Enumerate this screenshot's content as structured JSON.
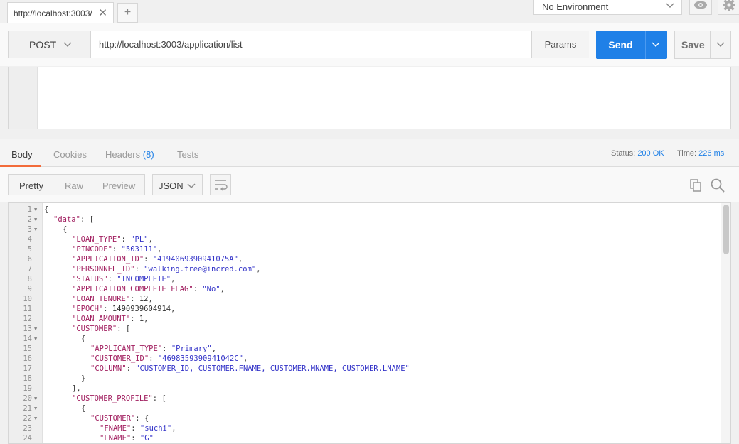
{
  "tab": {
    "title": "http://localhost:3003/",
    "close": "✕",
    "new": "+"
  },
  "environment": {
    "selected": "No Environment"
  },
  "request": {
    "method": "POST",
    "url": "http://localhost:3003/application/list",
    "params_label": "Params",
    "send_label": "Send",
    "save_label": "Save"
  },
  "response_tabs": {
    "body": "Body",
    "cookies": "Cookies",
    "headers": "Headers",
    "headers_count": "(8)",
    "tests": "Tests"
  },
  "status": {
    "label": "Status:",
    "value": "200 OK"
  },
  "time": {
    "label": "Time:",
    "value": "226 ms"
  },
  "view": {
    "pretty": "Pretty",
    "raw": "Raw",
    "preview": "Preview",
    "format": "JSON"
  },
  "code_lines": [
    {
      "n": "1",
      "fold": true,
      "indent": 0,
      "parts": [
        [
          "p",
          "{"
        ]
      ]
    },
    {
      "n": "2",
      "fold": true,
      "indent": 1,
      "parts": [
        [
          "k",
          "\"data\""
        ],
        [
          "p",
          ": ["
        ]
      ]
    },
    {
      "n": "3",
      "fold": true,
      "indent": 2,
      "parts": [
        [
          "p",
          "{"
        ]
      ]
    },
    {
      "n": "4",
      "fold": false,
      "indent": 3,
      "parts": [
        [
          "k",
          "\"LOAN_TYPE\""
        ],
        [
          "p",
          ": "
        ],
        [
          "s",
          "\"PL\""
        ],
        [
          "p",
          ","
        ]
      ]
    },
    {
      "n": "5",
      "fold": false,
      "indent": 3,
      "parts": [
        [
          "k",
          "\"PINCODE\""
        ],
        [
          "p",
          ": "
        ],
        [
          "s",
          "\"503111\""
        ],
        [
          "p",
          ","
        ]
      ]
    },
    {
      "n": "6",
      "fold": false,
      "indent": 3,
      "parts": [
        [
          "k",
          "\"APPLICATION_ID\""
        ],
        [
          "p",
          ": "
        ],
        [
          "s",
          "\"4194069390941075A\""
        ],
        [
          "p",
          ","
        ]
      ]
    },
    {
      "n": "7",
      "fold": false,
      "indent": 3,
      "parts": [
        [
          "k",
          "\"PERSONNEL_ID\""
        ],
        [
          "p",
          ": "
        ],
        [
          "s",
          "\"walking.tree@incred.com\""
        ],
        [
          "p",
          ","
        ]
      ]
    },
    {
      "n": "8",
      "fold": false,
      "indent": 3,
      "parts": [
        [
          "k",
          "\"STATUS\""
        ],
        [
          "p",
          ": "
        ],
        [
          "s",
          "\"INCOMPLETE\""
        ],
        [
          "p",
          ","
        ]
      ]
    },
    {
      "n": "9",
      "fold": false,
      "indent": 3,
      "parts": [
        [
          "k",
          "\"APPLICATION_COMPLETE_FLAG\""
        ],
        [
          "p",
          ": "
        ],
        [
          "s",
          "\"No\""
        ],
        [
          "p",
          ","
        ]
      ]
    },
    {
      "n": "10",
      "fold": false,
      "indent": 3,
      "parts": [
        [
          "k",
          "\"LOAN_TENURE\""
        ],
        [
          "p",
          ": "
        ],
        [
          "n",
          "12"
        ],
        [
          "p",
          ","
        ]
      ]
    },
    {
      "n": "11",
      "fold": false,
      "indent": 3,
      "parts": [
        [
          "k",
          "\"EPOCH\""
        ],
        [
          "p",
          ": "
        ],
        [
          "n",
          "1490939604914"
        ],
        [
          "p",
          ","
        ]
      ]
    },
    {
      "n": "12",
      "fold": false,
      "indent": 3,
      "parts": [
        [
          "k",
          "\"LOAN_AMOUNT\""
        ],
        [
          "p",
          ": "
        ],
        [
          "n",
          "1"
        ],
        [
          "p",
          ","
        ]
      ]
    },
    {
      "n": "13",
      "fold": true,
      "indent": 3,
      "parts": [
        [
          "k",
          "\"CUSTOMER\""
        ],
        [
          "p",
          ": ["
        ]
      ]
    },
    {
      "n": "14",
      "fold": true,
      "indent": 4,
      "parts": [
        [
          "p",
          "{"
        ]
      ]
    },
    {
      "n": "15",
      "fold": false,
      "indent": 5,
      "parts": [
        [
          "k",
          "\"APPLICANT_TYPE\""
        ],
        [
          "p",
          ": "
        ],
        [
          "s",
          "\"Primary\""
        ],
        [
          "p",
          ","
        ]
      ]
    },
    {
      "n": "16",
      "fold": false,
      "indent": 5,
      "parts": [
        [
          "k",
          "\"CUSTOMER_ID\""
        ],
        [
          "p",
          ": "
        ],
        [
          "s",
          "\"4698359390941042C\""
        ],
        [
          "p",
          ","
        ]
      ]
    },
    {
      "n": "17",
      "fold": false,
      "indent": 5,
      "parts": [
        [
          "k",
          "\"COLUMN\""
        ],
        [
          "p",
          ": "
        ],
        [
          "s",
          "\"CUSTOMER_ID, CUSTOMER.FNAME, CUSTOMER.MNAME, CUSTOMER.LNAME\""
        ]
      ]
    },
    {
      "n": "18",
      "fold": false,
      "indent": 4,
      "parts": [
        [
          "p",
          "}"
        ]
      ]
    },
    {
      "n": "19",
      "fold": false,
      "indent": 3,
      "parts": [
        [
          "p",
          "],"
        ]
      ]
    },
    {
      "n": "20",
      "fold": true,
      "indent": 3,
      "parts": [
        [
          "k",
          "\"CUSTOMER_PROFILE\""
        ],
        [
          "p",
          ": ["
        ]
      ]
    },
    {
      "n": "21",
      "fold": true,
      "indent": 4,
      "parts": [
        [
          "p",
          "{"
        ]
      ]
    },
    {
      "n": "22",
      "fold": true,
      "indent": 5,
      "parts": [
        [
          "k",
          "\"CUSTOMER\""
        ],
        [
          "p",
          ": {"
        ]
      ]
    },
    {
      "n": "23",
      "fold": false,
      "indent": 6,
      "parts": [
        [
          "k",
          "\"FNAME\""
        ],
        [
          "p",
          ": "
        ],
        [
          "s",
          "\"suchi\""
        ],
        [
          "p",
          ","
        ]
      ]
    },
    {
      "n": "24",
      "fold": false,
      "indent": 6,
      "parts": [
        [
          "k",
          "\"LNAME\""
        ],
        [
          "p",
          ": "
        ],
        [
          "s",
          "\"G\""
        ]
      ]
    }
  ]
}
